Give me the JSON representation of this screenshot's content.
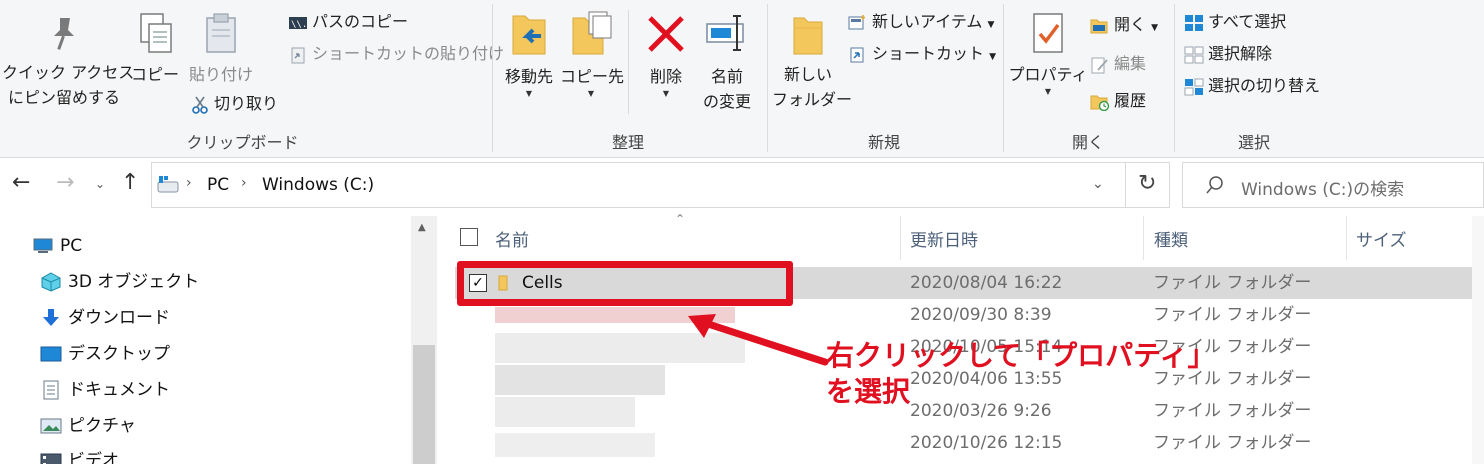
{
  "ribbon": {
    "clipboard": {
      "pin_label_1": "クイック アクセス",
      "pin_label_2": "にピン留めする",
      "copy_label": "コピー",
      "paste_label": "貼り付け",
      "copy_path_label": "パスのコピー",
      "paste_shortcut_label": "ショートカットの貼り付け",
      "cut_label": "切り取り",
      "group_label": "クリップボード"
    },
    "organize": {
      "move_to_label": "移動先",
      "copy_to_label": "コピー先",
      "delete_label": "削除",
      "rename_label_1": "名前",
      "rename_label_2": "の変更",
      "group_label": "整理"
    },
    "new": {
      "new_folder_label_1": "新しい",
      "new_folder_label_2": "フォルダー",
      "new_item_label": "新しいアイテム",
      "easy_access_label": "ショートカット",
      "group_label": "新規"
    },
    "open": {
      "properties_label": "プロパティ",
      "open_label": "開く",
      "edit_label": "編集",
      "history_label": "履歴",
      "group_label": "開く"
    },
    "select": {
      "select_all_label": "すべて選択",
      "select_none_label": "選択解除",
      "invert_selection_label": "選択の切り替え",
      "group_label": "選択"
    }
  },
  "address": {
    "crumb_pc": "PC",
    "crumb_drive": "Windows  (C:)",
    "search_placeholder": "Windows  (C:)の検索"
  },
  "navpane": {
    "items": [
      {
        "label": "PC",
        "icon": "pc-icon"
      },
      {
        "label": "3D オブジェクト",
        "icon": "3d-objects-icon"
      },
      {
        "label": "ダウンロード",
        "icon": "download-icon"
      },
      {
        "label": "デスクトップ",
        "icon": "desktop-icon"
      },
      {
        "label": "ドキュメント",
        "icon": "documents-icon"
      },
      {
        "label": "ピクチャ",
        "icon": "pictures-icon"
      },
      {
        "label": "ビデオ",
        "icon": "videos-icon"
      }
    ]
  },
  "filelist": {
    "columns": {
      "name": "名前",
      "modified": "更新日時",
      "type": "種類",
      "size": "サイズ"
    },
    "rows": [
      {
        "name": "Cells",
        "modified": "2020/08/04 16:22",
        "type": "ファイル フォルダー",
        "selected": true
      },
      {
        "name": "",
        "modified": "2020/09/30 8:39",
        "type": "ファイル フォルダー"
      },
      {
        "name": "",
        "modified": "2020/10/05 15:14",
        "type": "ファイル フォルダー"
      },
      {
        "name": "",
        "modified": "2020/04/06 13:55",
        "type": "ファイル フォルダー"
      },
      {
        "name": "",
        "modified": "2020/03/26 9:26",
        "type": "ファイル フォルダー"
      },
      {
        "name": "",
        "modified": "2020/10/26 12:15",
        "type": "ファイル フォルダー"
      }
    ]
  },
  "annotation": {
    "line_1": "右クリックして「プロパティ」",
    "line_2": "を選択",
    "color": "#e01020"
  },
  "colors": {
    "ribbon_bg": "#f5f6f7",
    "selection_bg": "#d9d9d9",
    "accent_blue": "#0078d7"
  }
}
